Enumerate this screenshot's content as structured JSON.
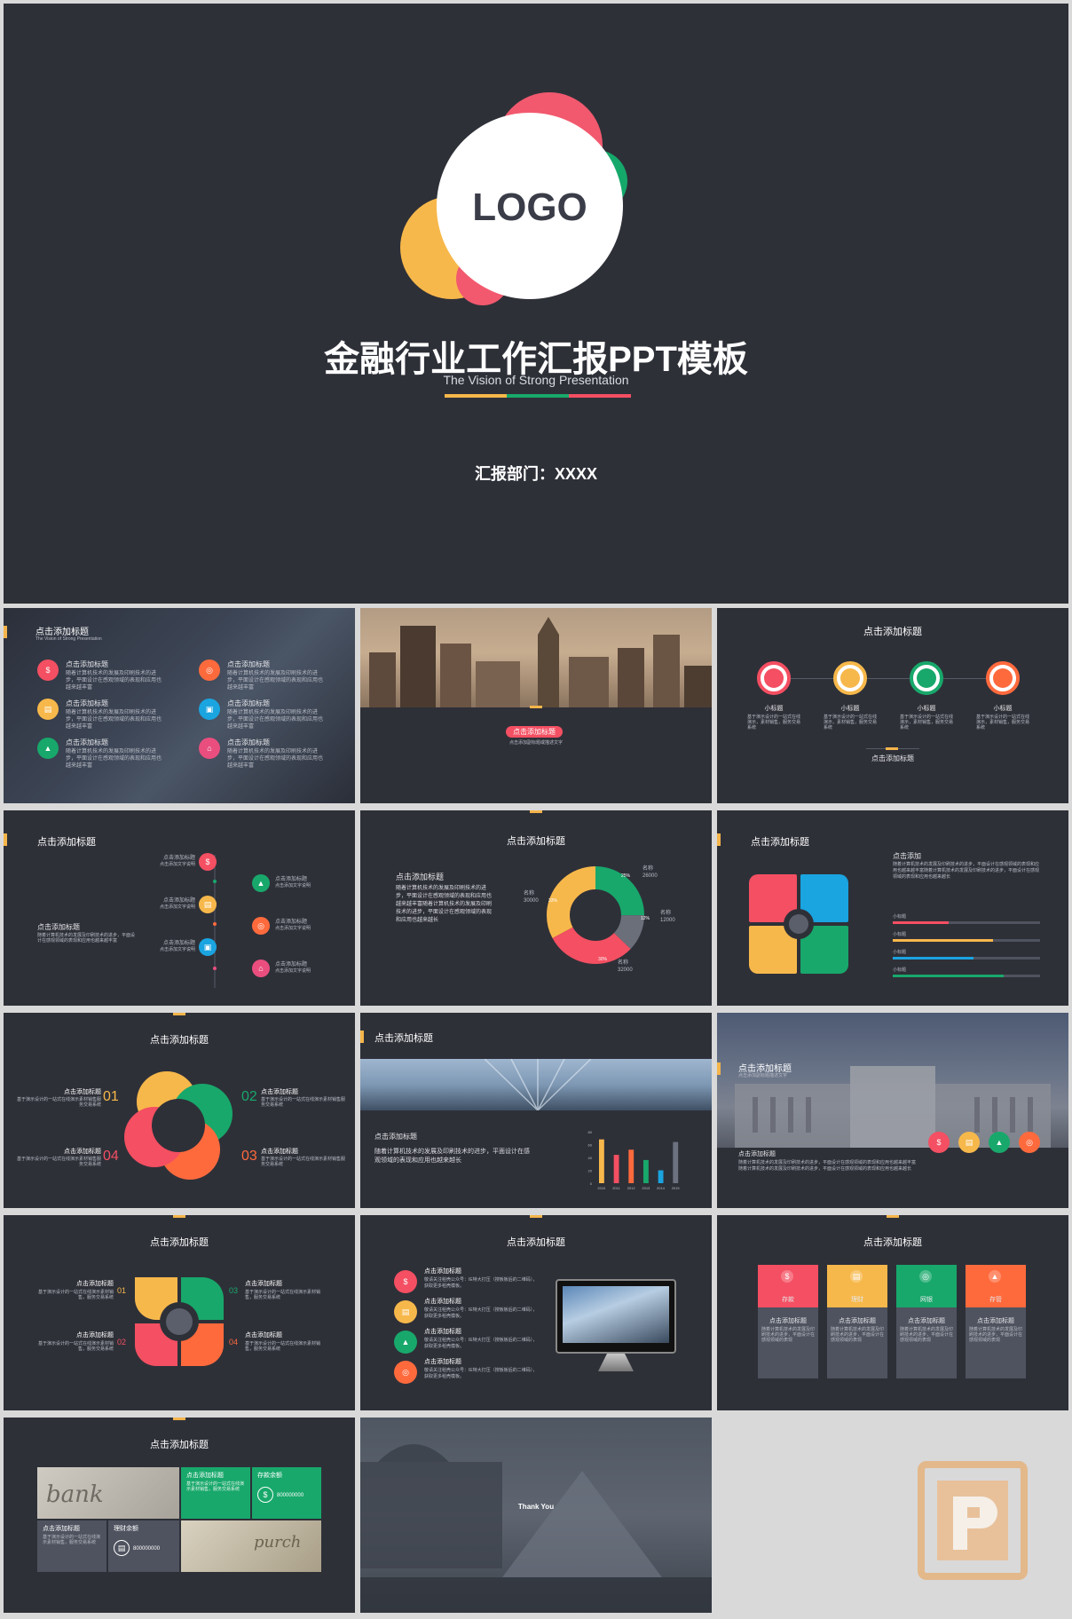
{
  "cover": {
    "logo": "LOGO",
    "title": "金融行业工作汇报PPT模板",
    "subtitle": "The Vision of Strong Presentation",
    "dept": "汇报部门：XXXX"
  },
  "colors": {
    "bg": "#2e3038",
    "red": "#f44f62",
    "yellow": "#f7b84b",
    "green": "#18a86b",
    "blue": "#1aa4e0",
    "orange": "#ff6a3d",
    "pink": "#e94e7f"
  },
  "common": {
    "title": "点击添加标题",
    "subtitle_en": "The Vision of Strong Presentation",
    "item_title": "点击添加标题",
    "item_desc": "随着计算机技术的发展及印刷技术的进步，平面设计在感观领域的表现和应用也越来越丰富",
    "small_title": "小标题",
    "small_desc": "基于演示设计的一站式在线演示，素材销售，服务交易系统"
  },
  "s2": {
    "pill": "点击添加标题",
    "caption": "点击添加副标题或描述文字"
  },
  "s3": {
    "labels": [
      "小标题",
      "小标题",
      "小标题",
      "小标题"
    ],
    "footer": "点击添加标题"
  },
  "s4": {
    "side_title": "点击添加标题",
    "item_label": "点击添加标题",
    "item_sub": "点击添加文字说明"
  },
  "s5": {
    "body_title": "点击添加标题",
    "body_text": "随着计算机技术的发展及印刷技术的进步，平面设计在感观领域的表现和应用也越来越丰富随着计算机技术的发展及印刷技术的进步，平面设计在感观领域的表现和应用也越来越长",
    "labels": [
      {
        "name": "名称",
        "value": "26000",
        "pct": "25%"
      },
      {
        "name": "名称",
        "value": "12000",
        "pct": "12%"
      },
      {
        "name": "名称",
        "value": "32000",
        "pct": "30%"
      },
      {
        "name": "名称",
        "value": "30000",
        "pct": "33%"
      }
    ]
  },
  "s6": {
    "head": "点击添加",
    "text": "随着计算机技术的发展及印刷技术的进步，平面设计在感观领域的表现和应用也越来越丰富随着计算机技术的发展及印刷技术的进步，平面设计在感观领域的表现和应用也越来越长",
    "bars": [
      {
        "label": "小标题",
        "fill": 0.38,
        "color": "#f44f62"
      },
      {
        "label": "小标题",
        "fill": 0.68,
        "color": "#f7b84b"
      },
      {
        "label": "小标题",
        "fill": 0.55,
        "color": "#1aa4e0"
      },
      {
        "label": "小标题",
        "fill": 0.75,
        "color": "#18a86b"
      }
    ]
  },
  "s7": {
    "nums": [
      "01",
      "02",
      "03",
      "04"
    ],
    "item": "点击添加标题",
    "desc": "基于演示设计的一站式在线演示素材销售服务交易系统"
  },
  "s8": {
    "item": "点击添加标题",
    "text": "随着计算机技术的发展及印刷技术的进步，平面设计在感观领域的表现和应用也越来越长"
  },
  "chart_data": {
    "type": "bar",
    "categories": [
      "2010",
      "2011",
      "2012",
      "2013",
      "2014",
      "2015"
    ],
    "values": [
      85,
      55,
      65,
      45,
      25,
      80
    ],
    "ylim": [
      0,
      100
    ],
    "yticks": [
      "80",
      "60",
      "40",
      "20",
      "0"
    ],
    "colors": [
      "#f7b84b",
      "#f44f62",
      "#ff6a3d",
      "#18a86b",
      "#1aa4e0",
      "#6d7280"
    ]
  },
  "s9": {
    "title": "点击添加标题",
    "sub": "点击添加副标题描述文字",
    "text_title": "点击添加标题",
    "text": "随着计算机技术的发展及印刷技术的进步，平面设计在感观领域的表现和应用也越来越丰富随着计算机技术的发展及印刷技术的进步，平面设计在感观领域的表现和应用也越来越长"
  },
  "s10": {
    "nums": [
      "01",
      "02",
      "03",
      "04"
    ],
    "item": "点击添加标题",
    "desc": "基于演示设计的一站式在线演示素材销售，服务交易系统"
  },
  "s11": {
    "item": "点击添加标题",
    "desc": "敬请关注稻壳公众号：IE特大打压（搜板板后的二维码），获取更多稻壳模板。"
  },
  "s12": {
    "tabs": [
      "存款",
      "理财",
      "网银",
      "存管"
    ],
    "item": "点击添加标题",
    "desc": "随着计算机技术的发展及印刷技术的进步，平面设计在感观领域的表现"
  },
  "s13": {
    "img_word": "bank",
    "green_title": "点击添加标题",
    "green_desc": "基于演示设计的一站式在线演示素材销售，服务交易系统",
    "deposit_label": "存款余额",
    "deposit_value": "800000000",
    "gray_title": "点击添加标题",
    "gray_desc": "基于演示设计的一站式在线演示素材销售，服务交易系统",
    "wealth_label": "理财余额",
    "wealth_value": "800000000",
    "img_word2": "purch"
  },
  "s14": {
    "text": "Thank You"
  }
}
